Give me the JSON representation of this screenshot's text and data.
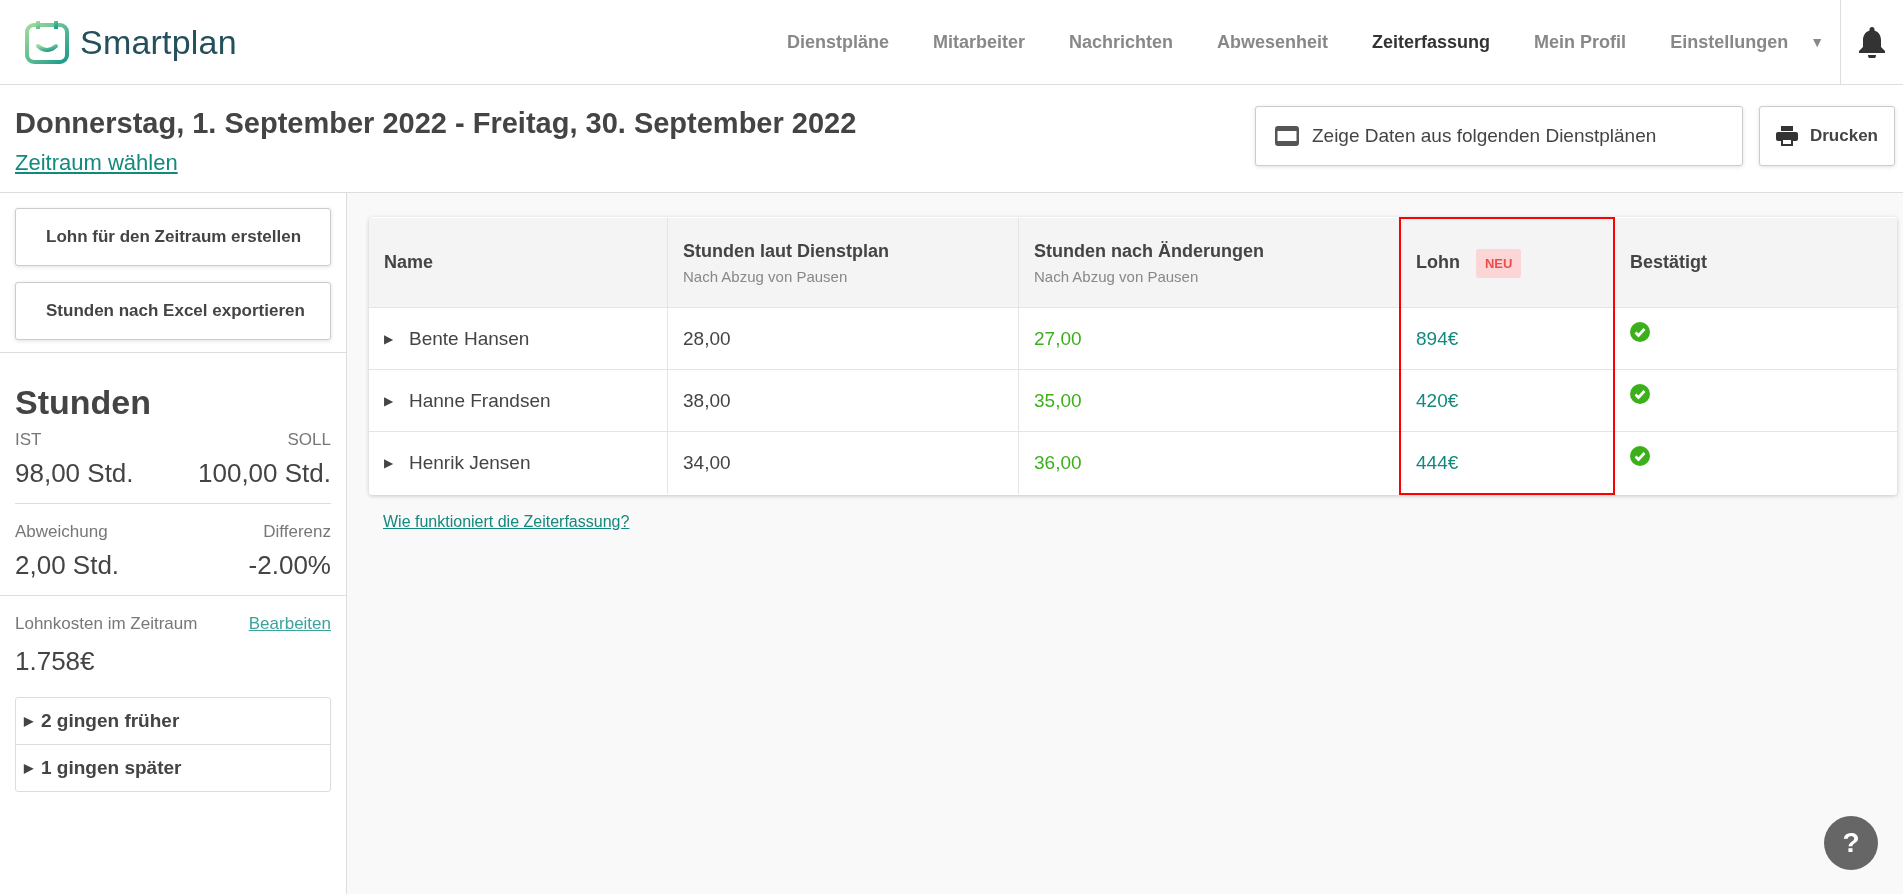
{
  "brand": {
    "name": "Smartplan"
  },
  "nav": [
    {
      "label": "Dienstpläne",
      "selected": false
    },
    {
      "label": "Mitarbeiter",
      "selected": false
    },
    {
      "label": "Nachrichten",
      "selected": false
    },
    {
      "label": "Abwesenheit",
      "selected": false
    },
    {
      "label": "Zeiterfassung",
      "selected": true
    },
    {
      "label": "Mein Profil",
      "selected": false
    },
    {
      "label": "Einstellungen",
      "selected": false
    }
  ],
  "nav_dropdown": "▼",
  "title": "Donnerstag, 1. September 2022 - Freitag, 30. September 2022",
  "period_link": "Zeitraum wählen",
  "toolbar": [
    {
      "label": "Zeige Daten aus folgenden Dienstplänen",
      "kind": "schedules"
    },
    {
      "label": "Drucken",
      "kind": "print"
    }
  ],
  "sidebar": {
    "buttons": [
      "Lohn für den Zeitraum erstellen",
      "Stunden nach Excel exportieren"
    ],
    "heading": "Stunden",
    "stats": [
      {
        "left_label": "IST",
        "left_value": "98,00 Std.",
        "right_label": "SOLL",
        "right_value": "100,00 Std."
      },
      {
        "left_label": "Abweichung",
        "left_value": "2,00 Std.",
        "right_label": "Differenz",
        "right_value": "-2.00%"
      }
    ],
    "wage_label": "Lohnkosten im Zeitraum",
    "wage_edit": "Bearbeiten",
    "wage_total": "1.758€",
    "groups": [
      {
        "marker": "▶",
        "label": "2 gingen früher",
        "expanded": false
      },
      {
        "marker": "▶",
        "label": "1 gingen später",
        "expanded": false
      }
    ]
  },
  "table": {
    "columns": [
      {
        "title": "Name",
        "highlighted": false
      },
      {
        "title": "Stunden laut Dienstplan",
        "subtitle": "Nach Abzug von Pausen",
        "highlighted": false
      },
      {
        "title": "Stunden nach Änderungen",
        "subtitle": "Nach Abzug von Pausen",
        "highlighted": false
      },
      {
        "title": "Lohn",
        "badge": "NEU",
        "highlighted": true
      },
      {
        "title": "Bestätigt",
        "highlighted": false
      }
    ],
    "rows": [
      {
        "marker": "▶",
        "expanded": false,
        "name": "Bente Hansen",
        "planned": "28,00",
        "changed": "27,00",
        "wage": "894€",
        "confirmed": true
      },
      {
        "marker": "▶",
        "expanded": false,
        "name": "Hanne Frandsen",
        "planned": "38,00",
        "changed": "35,00",
        "wage": "420€",
        "confirmed": true
      },
      {
        "marker": "▶",
        "expanded": false,
        "name": "Henrik Jensen",
        "planned": "34,00",
        "changed": "36,00",
        "wage": "444€",
        "confirmed": true
      }
    ]
  },
  "help_link": "Wie funktioniert die Zeiterfassung?",
  "help_button": "?"
}
